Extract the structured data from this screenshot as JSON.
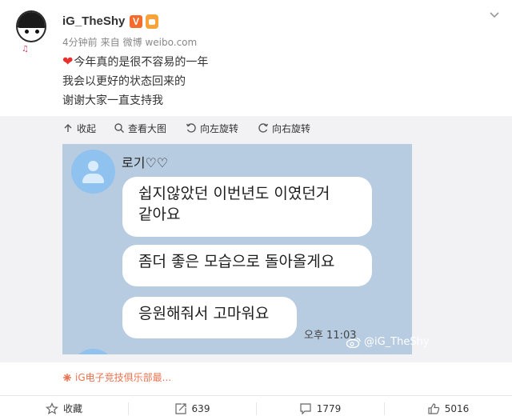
{
  "post": {
    "username": "iG_TheShy",
    "verified_badge": "V",
    "time_ago": "4分钟前",
    "source_prefix": "来自",
    "source_app": "微博 weibo.com",
    "lines": [
      "今年真的是很不容易的一年",
      "我会以更好的状态回来的",
      "谢谢大家一直支持我"
    ],
    "heart_icon": "heart-icon"
  },
  "toolbar": {
    "collapse": "收起",
    "view_large": "查看大图",
    "rotate_left": "向左旋转",
    "rotate_right": "向右旋转"
  },
  "chat_image": {
    "sender_name": "로기♡♡",
    "bubble_1": [
      "쉽지않았던 이번년도 이였던거",
      "같아요"
    ],
    "bubble_2": "좀더 좋은 모습으로 돌아올게요",
    "bubble_3": "응원해줘서 고마워요",
    "time": "오후 11:03",
    "watermark": "@iG_TheShy"
  },
  "source_link": "iG电子竞技俱乐部最...",
  "actions": {
    "favorite": "收藏",
    "repost_count": "639",
    "comment_count": "1779",
    "like_count": "5016"
  },
  "colors": {
    "accent_orange": "#eb7350",
    "chat_bg": "#b7cce1",
    "panel_bg": "#f2f2f5"
  }
}
